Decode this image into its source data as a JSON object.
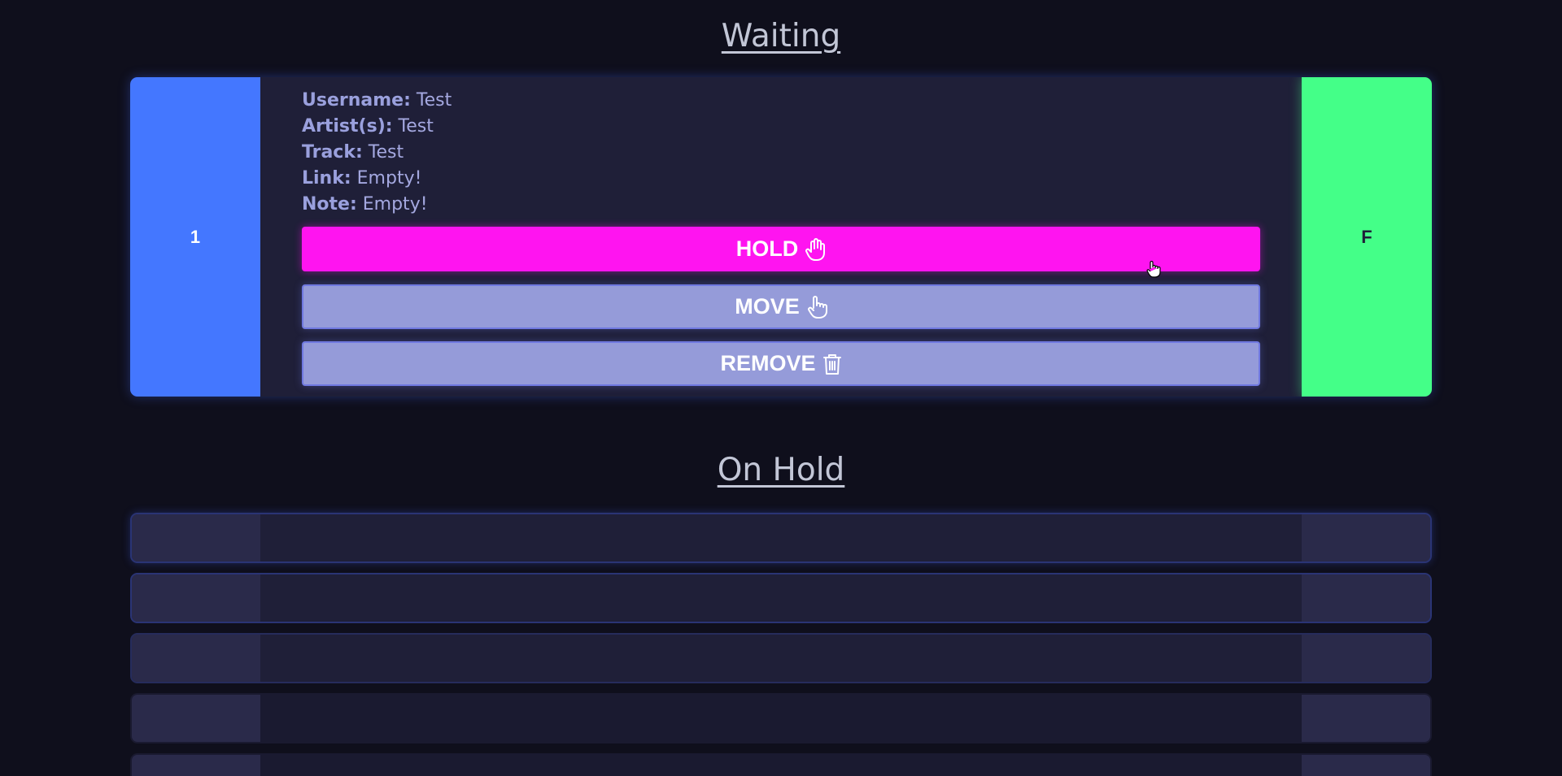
{
  "sections": {
    "waiting_title": "Waiting",
    "on_hold_title": "On Hold"
  },
  "waiting_card": {
    "position": "1",
    "tag": "F",
    "fields": {
      "username_label": "Username:",
      "username_value": "Test",
      "artists_label": "Artist(s):",
      "artists_value": "Test",
      "track_label": "Track:",
      "track_value": "Test",
      "link_label": "Link:",
      "link_value": "Empty!",
      "note_label": "Note:",
      "note_value": "Empty!"
    },
    "buttons": {
      "hold_label": "HOLD",
      "hold_icon": "hand-stop-icon",
      "move_label": "MOVE",
      "move_icon": "hand-pointer-icon",
      "remove_label": "REMOVE",
      "remove_icon": "trash-icon"
    }
  },
  "on_hold": {
    "rows": 5
  },
  "colors": {
    "background": "#0f0f1c",
    "card": "#1f1f38",
    "position_block": "#4477ff",
    "tag_block": "#44ff88",
    "hold_button": "#ff14f0",
    "secondary_button": "#959bd9",
    "text_label": "#9aa0dd"
  }
}
